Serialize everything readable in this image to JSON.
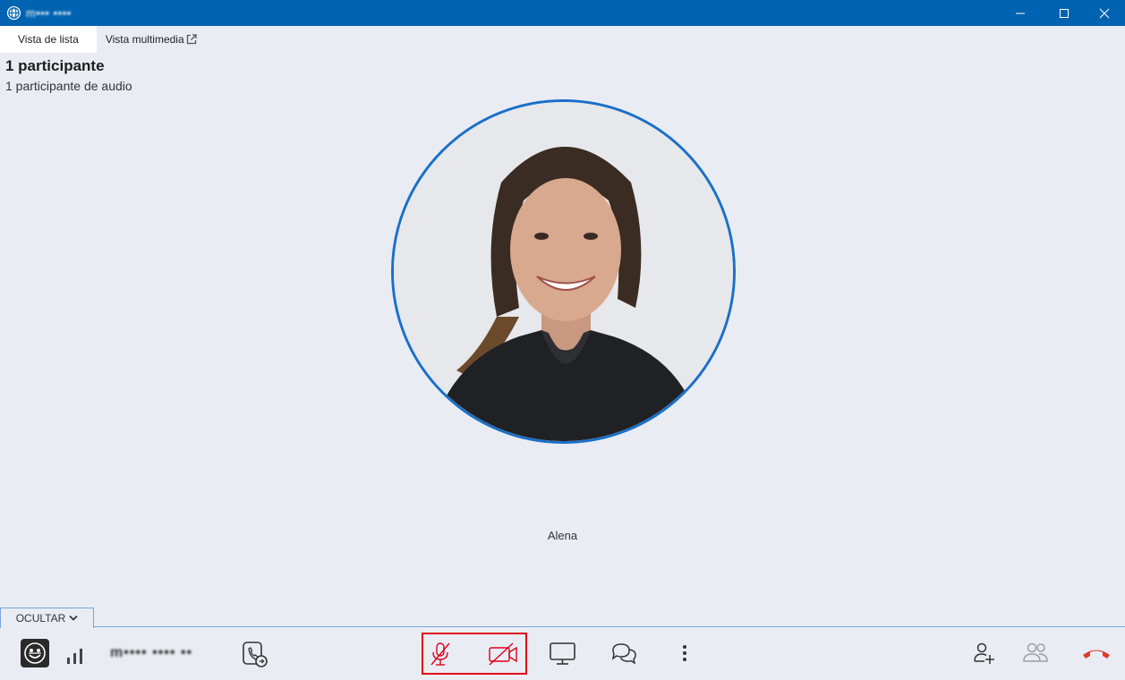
{
  "window": {
    "title": "m••• ••••",
    "icon": "globe-icon",
    "controls": [
      "minimize-icon",
      "maximize-icon",
      "close-icon"
    ]
  },
  "tabs": [
    {
      "label": "Vista de lista",
      "active": true
    },
    {
      "label": "Vista multimedia",
      "active": false
    }
  ],
  "popout_icon": "external-link-icon",
  "summary": {
    "title": "1 participante",
    "subtitle": "1 participante de audio"
  },
  "participant": {
    "name": "Alena",
    "ring_color": "#1a6fc9"
  },
  "toolbar": {
    "hide_label": "OCULTAR",
    "contact_name": "m•••• •••• ••",
    "icons": {
      "status": "emoji-status-icon",
      "signal": "signal-strength-icon",
      "dialpad": "dialpad-transfer-icon",
      "mic": "microphone-muted-icon",
      "camera": "camera-off-icon",
      "screen": "screen-share-icon",
      "chat": "chat-icon",
      "more": "more-vertical-icon",
      "add_user": "add-participant-icon",
      "people": "participants-icon",
      "hangup": "hang-up-icon"
    },
    "colors": {
      "muted_red": "#e0001b",
      "hangup_red": "#e23a28",
      "accent_blue": "#0063b1"
    }
  }
}
